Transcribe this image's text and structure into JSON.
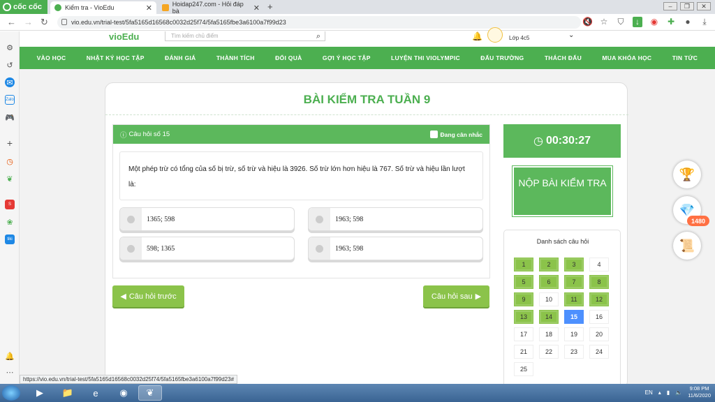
{
  "browser": {
    "brand": "cốc cốc",
    "tabs": [
      {
        "title": "Kiểm tra - VioEdu",
        "active": true
      },
      {
        "title": "Hoidap247.com - Hỏi đáp bà",
        "active": false
      }
    ],
    "new_tab": "+",
    "url": "vio.edu.vn/trial-test/5fa5165d16568c0032d25f74/5fa5165fbe3a6100a7f99d23",
    "status_url": "https://vio.edu.vn/trial-test/5fa5165d16568c0032d25f74/5fa5165fbe3a6100a7f99d23#"
  },
  "site": {
    "logo": "vioEdu",
    "search_placeholder": "Tìm kiếm chủ điểm",
    "user_class": "Lớp 4c5",
    "menu": [
      "VÀO HỌC",
      "NHẬT KÝ HỌC TẬP",
      "ĐÁNH GIÁ",
      "THÀNH TÍCH",
      "ĐỔI QUÀ",
      "GỢI Ý HỌC TẬP",
      "LUYỆN THI VIOLYMPIC",
      "ĐẤU TRƯỜNG",
      "THÁCH ĐẤU",
      "MUA KHÓA HỌC",
      "TIN TỨC"
    ]
  },
  "test": {
    "title": "BÀI KIỂM TRA TUẦN 9",
    "question_label": "Câu hỏi số 15",
    "considering_label": "Đang cân nhắc",
    "question_text": "Một phép trừ có tổng của số bị trừ, số trừ và hiệu là 3926. Số trừ lớn hơn hiệu là 767. Số trừ và hiệu lần lượt là:",
    "options": [
      "1365; 598",
      "1963; 598",
      "598; 1365",
      "1963; 598"
    ],
    "prev_button": "Câu hỏi trước",
    "next_button": "Câu hỏi sau",
    "timer": "00:30:27",
    "submit_button": "NỘP BÀI KIỂM TRA",
    "question_list_title": "Danh sách câu hỏi",
    "questions": [
      {
        "n": "1",
        "state": "done"
      },
      {
        "n": "2",
        "state": "done"
      },
      {
        "n": "3",
        "state": "done"
      },
      {
        "n": "4",
        "state": "todo"
      },
      {
        "n": "5",
        "state": "done"
      },
      {
        "n": "6",
        "state": "done"
      },
      {
        "n": "7",
        "state": "done"
      },
      {
        "n": "8",
        "state": "done"
      },
      {
        "n": "9",
        "state": "done"
      },
      {
        "n": "10",
        "state": "todo"
      },
      {
        "n": "11",
        "state": "done"
      },
      {
        "n": "12",
        "state": "done"
      },
      {
        "n": "13",
        "state": "done"
      },
      {
        "n": "14",
        "state": "done"
      },
      {
        "n": "15",
        "state": "current"
      },
      {
        "n": "16",
        "state": "todo"
      },
      {
        "n": "17",
        "state": "todo"
      },
      {
        "n": "18",
        "state": "todo"
      },
      {
        "n": "19",
        "state": "todo"
      },
      {
        "n": "20",
        "state": "todo"
      },
      {
        "n": "21",
        "state": "todo"
      },
      {
        "n": "22",
        "state": "todo"
      },
      {
        "n": "23",
        "state": "todo"
      },
      {
        "n": "24",
        "state": "todo"
      },
      {
        "n": "25",
        "state": "todo"
      }
    ],
    "gem_count": "1480"
  },
  "taskbar": {
    "lang": "EN",
    "time": "9:08 PM",
    "date": "11/6/2020"
  },
  "colors": {
    "primary_green": "#4caf50",
    "answered_green": "#8bc34a",
    "current_blue": "#4d90fe"
  }
}
